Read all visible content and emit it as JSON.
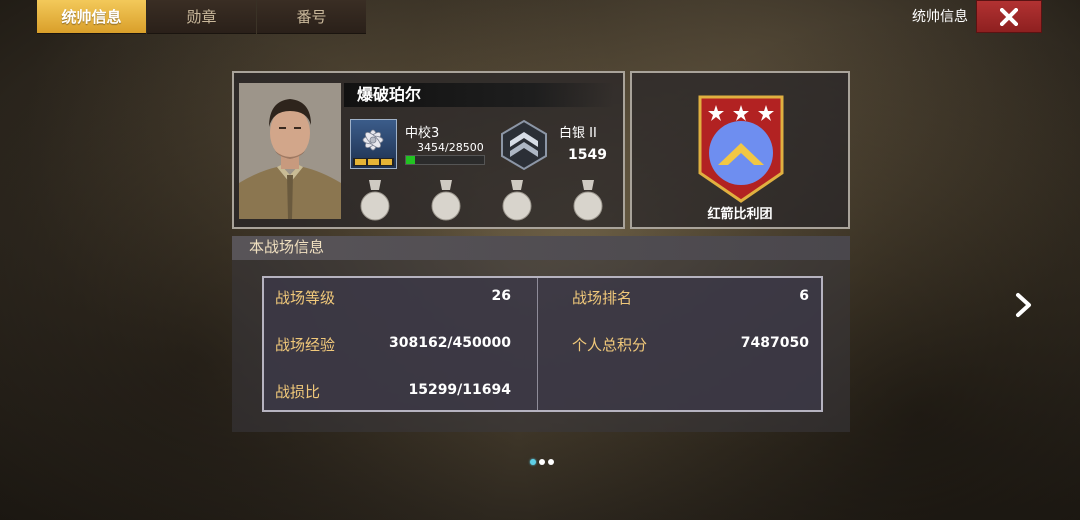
{
  "tabs": [
    {
      "label": "统帅信息",
      "active": true
    },
    {
      "label": "勋章",
      "active": false
    },
    {
      "label": "番号",
      "active": false
    }
  ],
  "header": {
    "title": "统帅信息",
    "close_icon": "close-icon"
  },
  "profile": {
    "name": "爆破珀尔",
    "rank": {
      "name": "中校3",
      "exp": "3454/28500",
      "exp_fraction": 0.121
    },
    "tier": {
      "name": "白银 II",
      "score": "1549"
    },
    "medal_slots": 4
  },
  "legion": {
    "name": "红箭比利团",
    "color": "#b22222"
  },
  "battlefield": {
    "title": "本战场信息",
    "left": [
      {
        "label": "战场等级",
        "value": "26"
      },
      {
        "label": "战场经验",
        "value": "308162/450000"
      },
      {
        "label": "战损比",
        "value": "15299/11694"
      }
    ],
    "right": [
      {
        "label": "战场排名",
        "value": "6"
      },
      {
        "label": "个人总积分",
        "value": "7487050"
      }
    ]
  },
  "pager": {
    "count": 3,
    "active": 0
  },
  "colors": {
    "tab_active": "#e9b23f",
    "close": "#a82a2a",
    "label_gold": "#f0c87a",
    "exp_fill": "#22c322"
  }
}
